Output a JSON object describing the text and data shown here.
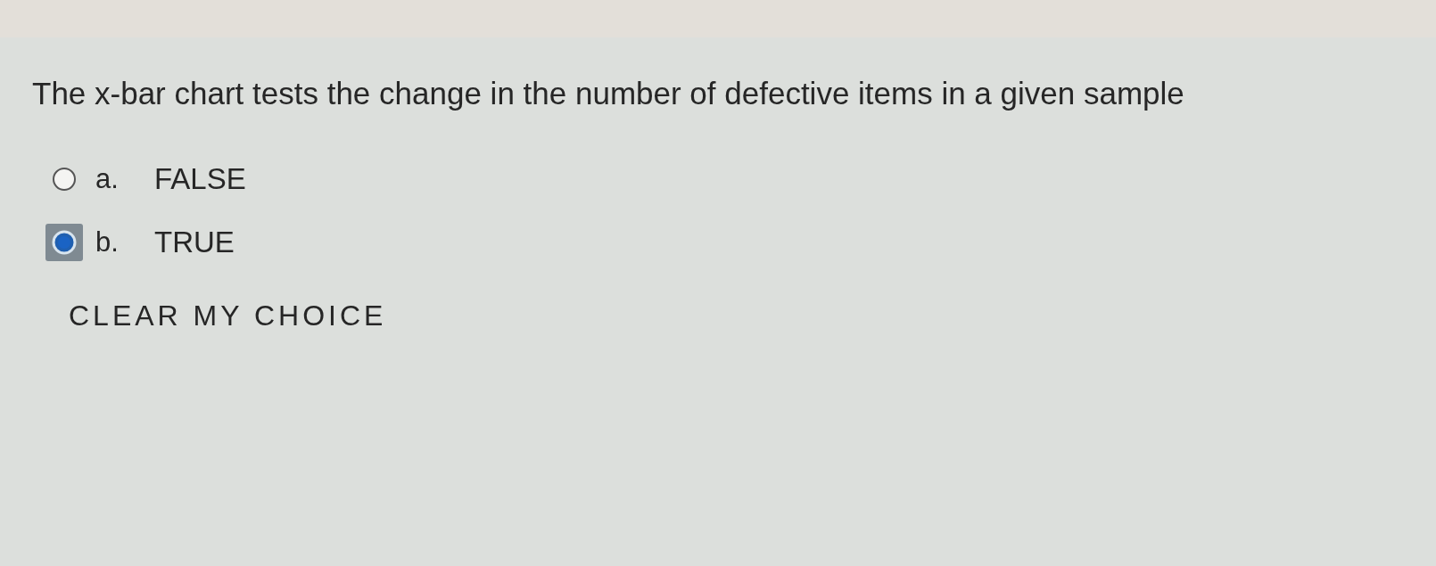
{
  "question": {
    "text": "The x-bar chart tests the change in the number of defective items in a given sample"
  },
  "options": [
    {
      "letter": "a.",
      "label": "FALSE",
      "selected": false
    },
    {
      "letter": "b.",
      "label": "TRUE",
      "selected": true
    }
  ],
  "clear_button": {
    "label": "CLEAR MY CHOICE"
  }
}
